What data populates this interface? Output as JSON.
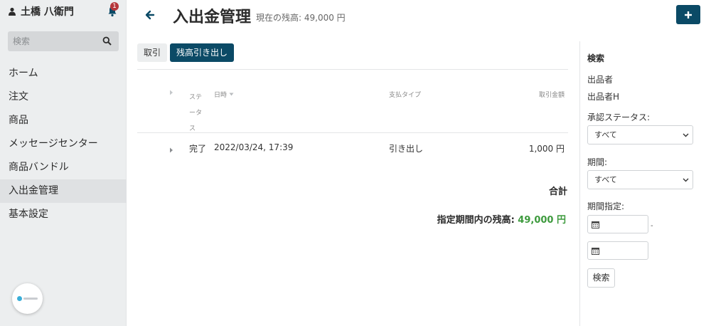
{
  "colors": {
    "primary": "#0b4a66",
    "badge": "#b5373a",
    "positive": "#3d9a3d",
    "sidebar_bg": "#eceeef"
  },
  "sidebar": {
    "user_name": "土橋 八衛門",
    "notification_count": "1",
    "search_placeholder": "検索",
    "items": [
      {
        "label": "ホーム"
      },
      {
        "label": "注文"
      },
      {
        "label": "商品"
      },
      {
        "label": "メッセージセンター"
      },
      {
        "label": "商品バンドル"
      },
      {
        "label": "入出金管理",
        "active": true
      },
      {
        "label": "基本設定"
      }
    ]
  },
  "header": {
    "title": "入出金管理",
    "balance_text": "現在の残高: 49,000 円"
  },
  "tabs": [
    {
      "label": "取引"
    },
    {
      "label": "残高引き出し",
      "active": true
    }
  ],
  "table": {
    "headers": {
      "status": "ステータス",
      "date": "日時",
      "type": "支払タイプ",
      "amount": "取引金額"
    },
    "rows": [
      {
        "status": "完了",
        "date": "2022/03/24, 17:39",
        "type": "引き出し",
        "amount": "1,000 円"
      }
    ]
  },
  "summary": {
    "total_label": "合計",
    "period_balance_label": "指定期間内の残高:",
    "period_balance_value": "49,000 円"
  },
  "filter": {
    "title": "検索",
    "seller_label": "出品者",
    "seller_value": "出品者H",
    "approval_label": "承認ステータス:",
    "approval_value": "すべて",
    "period_label": "期間:",
    "period_value": "すべて",
    "period_range_label": "期間指定:",
    "range_separator": "-",
    "search_button": "検索"
  }
}
